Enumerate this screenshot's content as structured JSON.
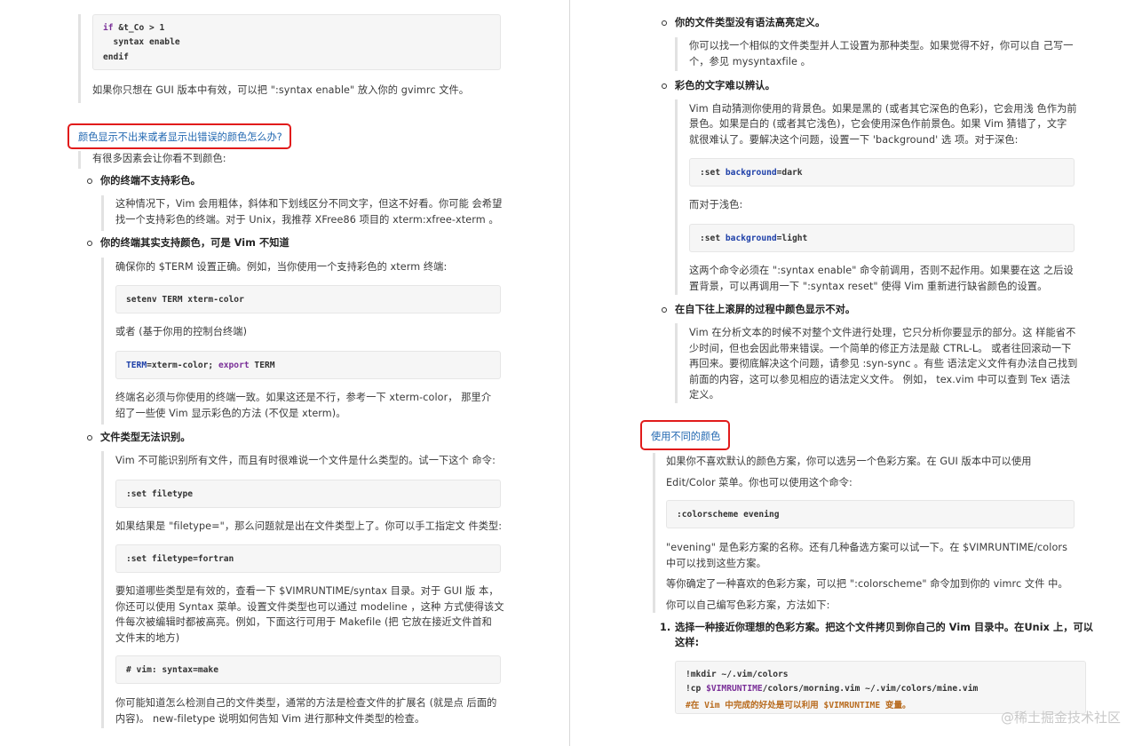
{
  "left": {
    "code1": [
      "if &t_Co > 1",
      "  syntax enable",
      "endif"
    ],
    "p_gui": "如果你只想在 GUI 版本中有效，可以把 \":syntax enable\" 放入你的 gvimrc 文件。",
    "heading": "颜色显示不出来或者显示出错误的颜色怎么办?",
    "intro": "有很多因素会让你看不到颜色:",
    "b1": {
      "title": "你的终端不支持彩色。",
      "lines": [
        "这种情况下，Vim 会用粗体，斜体和下划线区分不同文字，但这不好看。你可能 会希望",
        "找一个支持彩色的终端。对于 Unix，我推荐 XFree86 项目的 xterm:xfree-xterm 。"
      ]
    },
    "b2": {
      "title": "你的终端其实支持颜色，可是 Vim 不知道",
      "p1": "确保你的 $TERM 设置正确。例如，当你使用一个支持彩色的 xterm 终端:",
      "code1": "setenv TERM xterm-color",
      "p2": "或者 (基于你用的控制台终端)",
      "code2_a": "TERM",
      "code2_b": "=xterm-color; ",
      "code2_c": "export",
      "code2_d": " TERM",
      "lines": [
        "终端名必须与你使用的终端一致。如果这还是不行，参考一下 xterm-color， 那里介",
        "绍了一些使 Vim 显示彩色的方法 (不仅是 xterm)。"
      ]
    },
    "b3": {
      "title": "文件类型无法识别。",
      "p1": "Vim 不可能识别所有文件，而且有时很难说一个文件是什么类型的。试一下这个 命令:",
      "code1": ":set filetype",
      "p2": "如果结果是 \"filetype=\"，那么问题就是出在文件类型上了。你可以手工指定文 件类型:",
      "code2": ":set filetype=fortran",
      "lines": [
        "要知道哪些类型是有效的，查看一下 $VIMRUNTIME/syntax 目录。对于 GUI 版 本，",
        "你还可以使用 Syntax 菜单。设置文件类型也可以通过 modeline ，这种 方式使得该文",
        "件每次被编辑时都被高亮。例如，下面这行可用于 Makefile (把 它放在接近文件首和",
        "文件末的地方)"
      ],
      "code3": "# vim: syntax=make",
      "tail": [
        "你可能知道怎么检测自己的文件类型，通常的方法是检查文件的扩展名 (就是点 后面的",
        "内容)。 new-filetype 说明如何告知 Vim 进行那种文件类型的检查。"
      ]
    }
  },
  "right": {
    "b4": {
      "title": "你的文件类型没有语法高亮定义。",
      "lines": [
        "你可以找一个相似的文件类型并人工设置为那种类型。如果觉得不好，你可以自 己写一",
        "个，参见 mysyntaxfile 。"
      ]
    },
    "b5": {
      "title": "彩色的文字难以辨认。",
      "lines": [
        "Vim 自动猜测你使用的背景色。如果是黑的 (或者其它深色的色彩)，它会用浅 色作为前",
        "景色。如果是白的 (或者其它浅色)，它会使用深色作前景色。如果 Vim 猜错了，文字",
        "就很难认了。要解决这个问题，设置一下 'background' 选 项。对于深色:"
      ],
      "code1_a": ":set ",
      "code1_b": "background",
      "code1_c": "=dark",
      "p2": "而对于浅色:",
      "code2_a": ":set ",
      "code2_b": "background",
      "code2_c": "=light",
      "tail": [
        "这两个命令必须在 \":syntax enable\" 命令前调用，否则不起作用。如果要在这 之后设",
        "置背景，可以再调用一下 \":syntax reset\" 使得 Vim 重新进行缺省颜色的设置。"
      ]
    },
    "b6": {
      "title": "在自下往上滚屏的过程中颜色显示不对。",
      "lines": [
        "Vim 在分析文本的时候不对整个文件进行处理，它只分析你要显示的部分。这 样能省不",
        "少时间，但也会因此带来错误。一个简单的修正方法是敲 CTRL-L。 或者往回滚动一下",
        "再回来。要彻底解决这个问题，请参见 :syn-sync 。有些 语法定义文件有办法自己找到",
        "前面的内容，这可以参见相应的语法定义文件。 例如， tex.vim 中可以查到 Tex 语法",
        "定义。"
      ]
    },
    "heading": "使用不同的颜色",
    "p1": "如果你不喜欢默认的颜色方案，你可以选另一个色彩方案。在 GUI 版本中可以使用",
    "p2": "Edit/Color 菜单。你也可以使用这个命令:",
    "code1": ":colorscheme evening",
    "p3": [
      "\"evening\" 是色彩方案的名称。还有几种备选方案可以试一下。在 $VIMRUNTIME/colors",
      "中可以找到这些方案。"
    ],
    "p4": "等你确定了一种喜欢的色彩方案，可以把 \":colorscheme\" 命令加到你的 vimrc 文件 中。",
    "p5": "你可以自己编写色彩方案，方法如下:",
    "ol_num": "1.",
    "ol_lines": [
      "选择一种接近你理想的色彩方案。把这个文件拷贝到你自己的 Vim 目录中。在Unix 上，可以",
      "这样:"
    ],
    "code2_l1": "!mkdir ~/.vim/colors",
    "code2_l2_a": "!cp ",
    "code2_l2_b": "$VIMRUNTIME",
    "code2_l2_c": "/colors/morning.vim ~/.vim/colors/mine.vim",
    "code2_l3": "#在 Vim 中完成的好处是可以利用 $VIMRUNTIME 变量。"
  },
  "watermark": "@稀土掘金技术社区"
}
